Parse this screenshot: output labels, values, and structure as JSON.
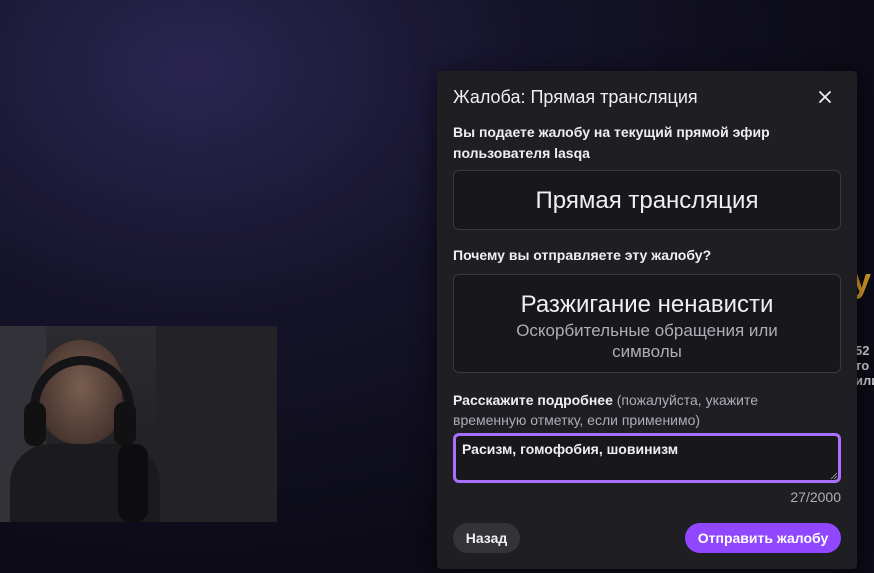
{
  "background": {
    "side_fragments": [
      "52",
      "то",
      "или"
    ]
  },
  "modal": {
    "title": "Жалоба: Прямая трансляция",
    "description": "Вы подаете жалобу на текущий прямой эфир пользователя lasqa",
    "content_type": "Прямая трансляция",
    "reason_question": "Почему вы отправляете эту жалобу?",
    "reason": {
      "main": "Разжигание ненависти",
      "sub": "Оскорбительные обращения или символы"
    },
    "details_label_bold": "Расскажите подробнее",
    "details_label_hint": " (пожалуйста, укажите временную отметку, если применимо)",
    "details_value": "Расизм, гомофобия, шовинизм",
    "char_counter": "27/2000",
    "back_label": "Назад",
    "submit_label": "Отправить жалобу",
    "colors": {
      "accent": "#9147ff",
      "focus_border": "#a970ff",
      "surface": "#1f1f23"
    }
  }
}
